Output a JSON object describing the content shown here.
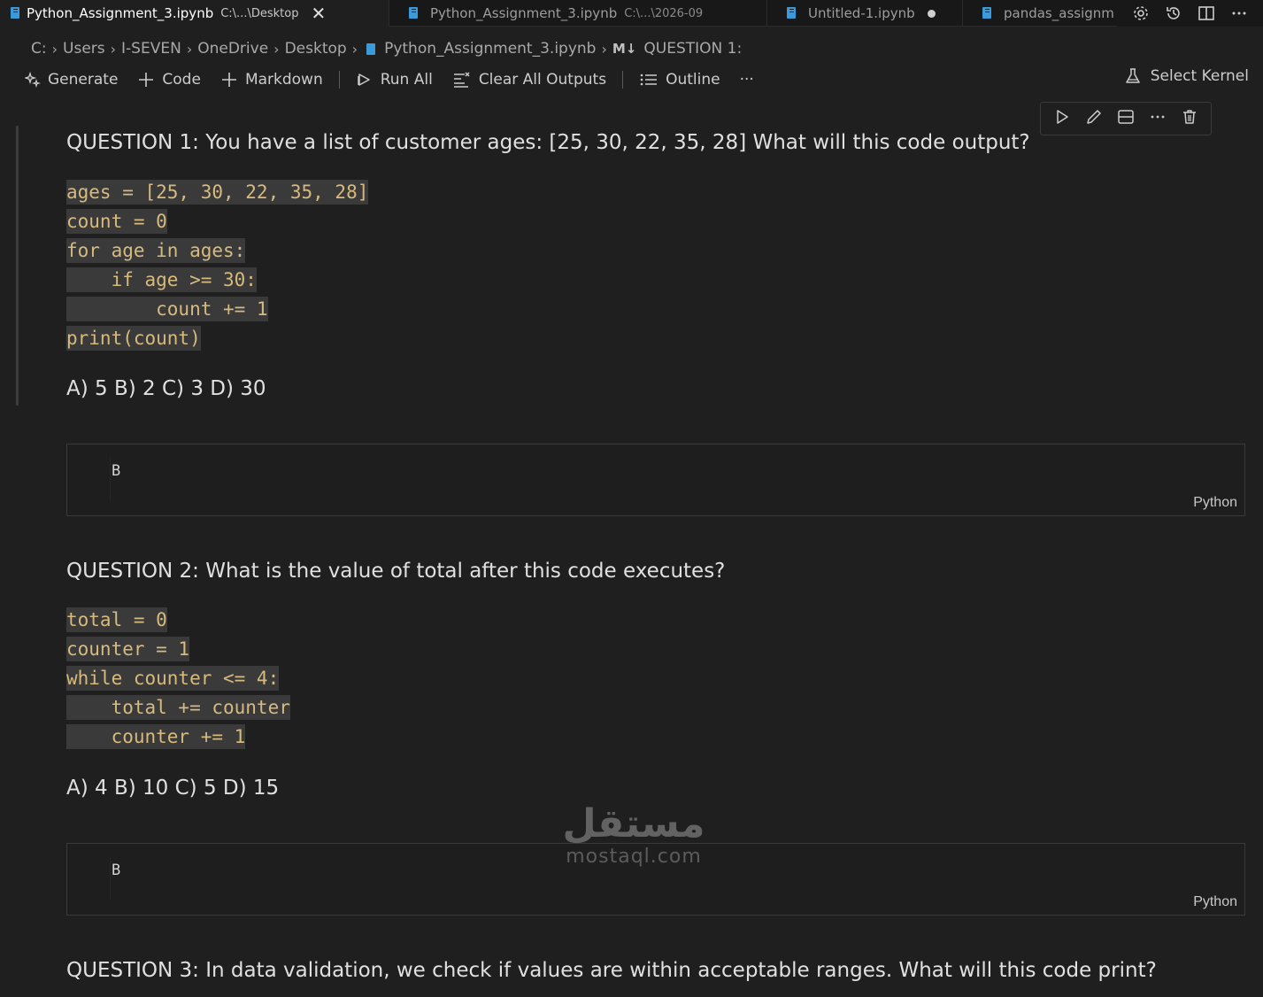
{
  "tabs": [
    {
      "title": "Python_Assignment_3.ipynb",
      "description": "C:\\...\\Desktop",
      "active": true,
      "close_glyph": "✕"
    },
    {
      "title": "Python_Assignment_3.ipynb",
      "description": "C:\\...\\2026-09",
      "active": false
    },
    {
      "title": "Untitled-1.ipynb",
      "description": "",
      "active": false,
      "dirty": true
    },
    {
      "title": "pandas_assignm",
      "description": "",
      "active": false
    }
  ],
  "breadcrumb": {
    "items": [
      "C:",
      "Users",
      "I-SEVEN",
      "OneDrive",
      "Desktop",
      "Python_Assignment_3.ipynb",
      "QUESTION 1:"
    ],
    "separator": "›"
  },
  "toolbar": {
    "generate": "Generate",
    "code": "Code",
    "markdown": "Markdown",
    "run_all": "Run All",
    "clear_all_outputs": "Clear All Outputs",
    "outline": "Outline",
    "more": "···",
    "select_kernel": "Select Kernel"
  },
  "questions": [
    {
      "heading": "QUESTION 1: You have a list of customer ages: [25, 30, 22, 35, 28] What will this code output?",
      "code": [
        "ages = [25, 30, 22, 35, 28]",
        "count = 0",
        "for age in ages:",
        "    if age >= 30:",
        "        count += 1",
        "print(count)"
      ],
      "choices": "A) 5 B) 2 C) 3 D) 30",
      "answer_cell": {
        "code": "B",
        "language": "Python"
      }
    },
    {
      "heading": "QUESTION 2: What is the value of total after this code executes?",
      "code": [
        "total = 0",
        "counter = 1",
        "while counter <= 4:",
        "    total += counter",
        "    counter += 1"
      ],
      "choices": "A) 4 B) 10 C) 5 D) 15",
      "answer_cell": {
        "code": "B",
        "language": "Python"
      }
    },
    {
      "heading": "QUESTION 3: In data validation, we check if values are within acceptable ranges. What will this code print?"
    }
  ],
  "watermark": {
    "arabic": "مستقل",
    "latin": "mostaql.com"
  },
  "colors": {
    "accent": "#3b9ad9",
    "code_text": "#d7ba7d",
    "background": "#1f1f1f"
  }
}
